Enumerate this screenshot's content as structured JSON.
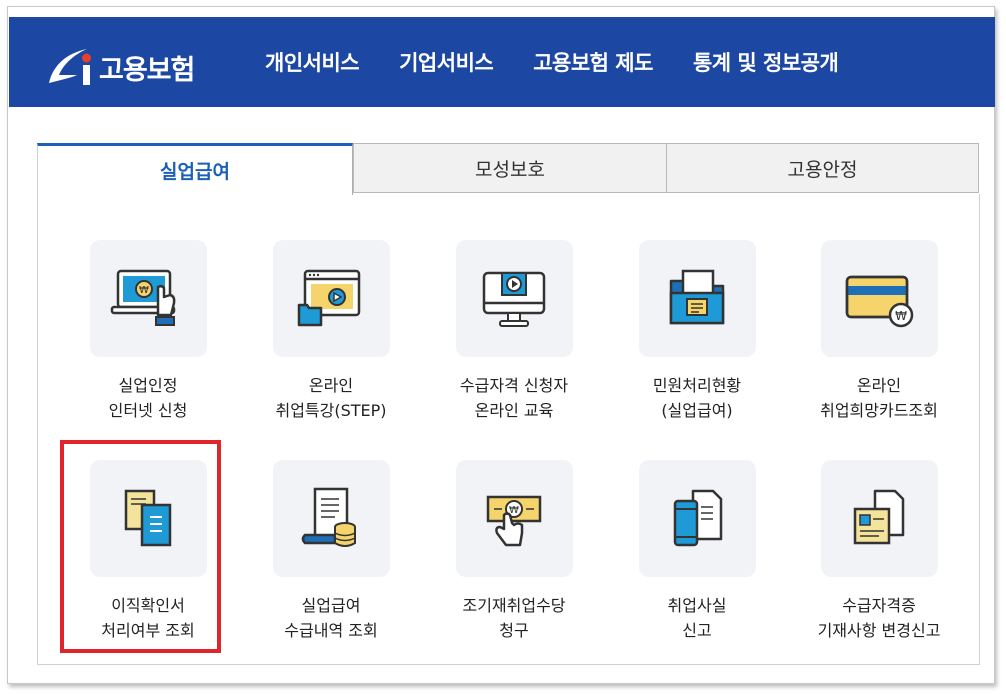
{
  "header": {
    "logo_text": "고용보험",
    "nav": [
      "개인서비스",
      "기업서비스",
      "고용보험 제도",
      "통계 및 정보공개"
    ],
    "bg_color": "#1c47a2"
  },
  "tabs": [
    {
      "label": "실업급여",
      "active": true
    },
    {
      "label": "모성보호",
      "active": false
    },
    {
      "label": "고용안정",
      "active": false
    }
  ],
  "items": [
    {
      "icon": "laptop-touch-icon",
      "line1": "실업인정",
      "line2": "인터넷 신청"
    },
    {
      "icon": "video-browser-icon",
      "line1": "온라인",
      "line2": "취업특강(STEP)"
    },
    {
      "icon": "monitor-play-icon",
      "line1": "수급자격 신청자",
      "line2": "온라인 교육"
    },
    {
      "icon": "folder-document-icon",
      "line1": "민원처리현황",
      "line2": "(실업급여)"
    },
    {
      "icon": "card-coin-icon",
      "line1": "온라인",
      "line2": "취업희망카드조회"
    },
    {
      "icon": "documents-icon",
      "line1": "이직확인서",
      "line2": "처리여부 조회"
    },
    {
      "icon": "scroll-coins-icon",
      "line1": "실업급여",
      "line2": "수급내역 조회"
    },
    {
      "icon": "hand-bill-icon",
      "line1": "조기재취업수당",
      "line2": "청구"
    },
    {
      "icon": "phone-document-icon",
      "line1": "취업사실",
      "line2": "신고"
    },
    {
      "icon": "document-photo-icon",
      "line1": "수급자격증",
      "line2": "기재사항 변경신고"
    }
  ],
  "highlight_color": "#e0242c"
}
